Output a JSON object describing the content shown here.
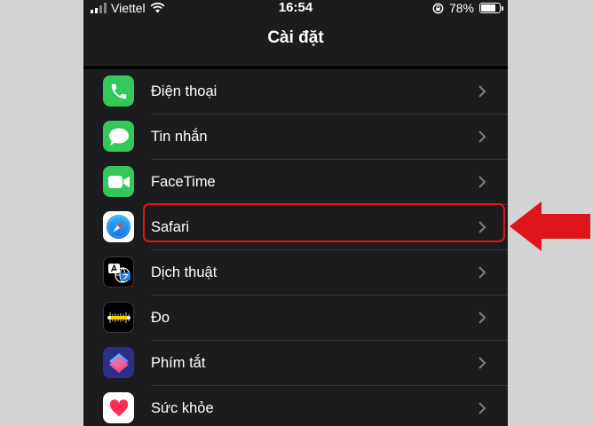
{
  "status_bar": {
    "carrier": "Viettel",
    "time": "16:54",
    "battery_percent": "78%",
    "battery_level": 0.78
  },
  "navbar": {
    "title": "Cài đặt"
  },
  "settings": [
    {
      "id": "phone",
      "label": "Điện thoại",
      "icon": "phone-icon",
      "color": "#34c759"
    },
    {
      "id": "messages",
      "label": "Tin nhắn",
      "icon": "messages-icon",
      "color": "#34c759"
    },
    {
      "id": "facetime",
      "label": "FaceTime",
      "icon": "facetime-icon",
      "color": "#34c759"
    },
    {
      "id": "safari",
      "label": "Safari",
      "icon": "safari-icon",
      "color": "#ffffff"
    },
    {
      "id": "translate",
      "label": "Dịch thuật",
      "icon": "translate-icon",
      "color": "#000000"
    },
    {
      "id": "measure",
      "label": "Đo",
      "icon": "measure-icon",
      "color": "#000000"
    },
    {
      "id": "shortcuts",
      "label": "Phím tắt",
      "icon": "shortcuts-icon",
      "color": "#2b2f8a"
    },
    {
      "id": "health",
      "label": "Sức khỏe",
      "icon": "health-icon",
      "color": "#ffffff"
    }
  ],
  "annotation": {
    "highlight_color": "#e0141b",
    "highlighted_item": "Safari"
  }
}
